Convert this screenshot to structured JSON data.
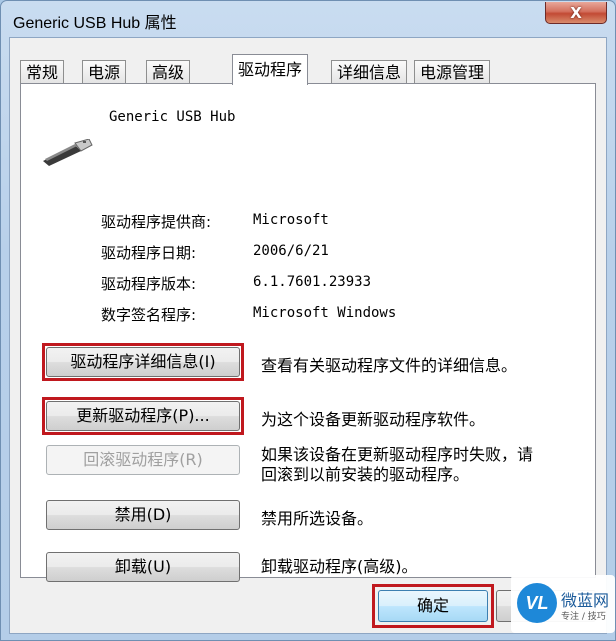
{
  "window": {
    "title": "Generic USB Hub 属性",
    "close_label": "X"
  },
  "tabs": [
    {
      "label": "常规"
    },
    {
      "label": "电源"
    },
    {
      "label": "高级"
    },
    {
      "label": "驱动程序",
      "active": true
    },
    {
      "label": "详细信息"
    },
    {
      "label": "电源管理"
    }
  ],
  "device": {
    "name": "Generic USB Hub",
    "icon": "usb-plug-icon"
  },
  "info": [
    {
      "label": "驱动程序提供商:",
      "value": "Microsoft"
    },
    {
      "label": "驱动程序日期:",
      "value": "2006/6/21"
    },
    {
      "label": "驱动程序版本:",
      "value": "6.1.7601.23933"
    },
    {
      "label": "数字签名程序:",
      "value": "Microsoft Windows"
    }
  ],
  "actions": [
    {
      "button": "驱动程序详细信息(I)",
      "desc": "查看有关驱动程序文件的详细信息。",
      "enabled": true,
      "highlighted": true
    },
    {
      "button": "更新驱动程序(P)...",
      "desc": "为这个设备更新驱动程序软件。",
      "enabled": true,
      "highlighted": true
    },
    {
      "button": "回滚驱动程序(R)",
      "desc_line1": "如果该设备在更新驱动程序时失败，请",
      "desc_line2": "回滚到以前安装的驱动程序。",
      "enabled": false,
      "highlighted": false
    },
    {
      "button": "禁用(D)",
      "desc": "禁用所选设备。",
      "enabled": true,
      "highlighted": false
    },
    {
      "button": "卸载(U)",
      "desc": "卸载驱动程序(高级)。",
      "enabled": true,
      "highlighted": false
    }
  ],
  "footer": {
    "ok_label": "确定"
  },
  "watermark": {
    "logo": "VL",
    "name": "微蓝网",
    "sub": "专注 / 技巧"
  },
  "colors": {
    "highlight": "#c0181e",
    "titlebar": "#b8d0ea",
    "close": "#c24a34"
  }
}
